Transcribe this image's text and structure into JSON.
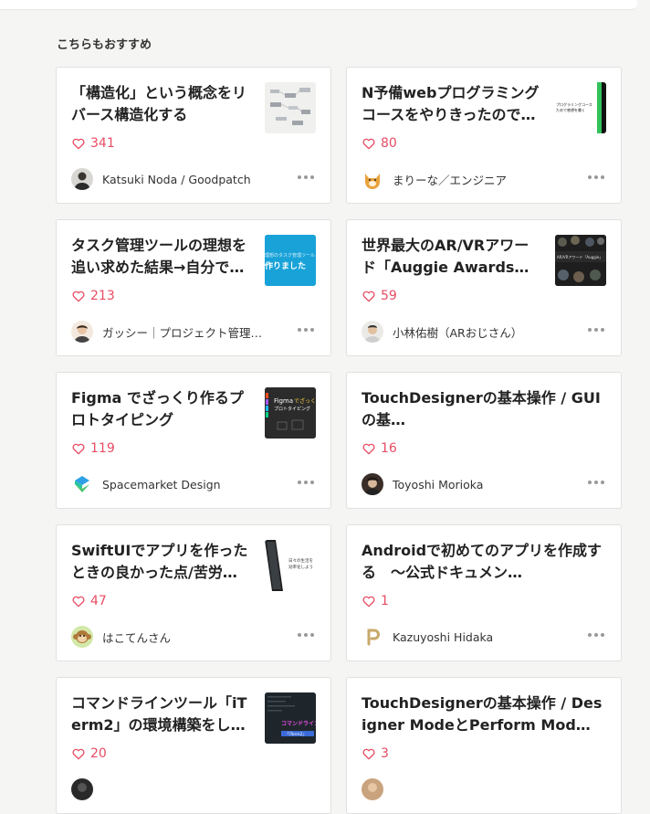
{
  "section": {
    "title": "こちらもおすすめ"
  },
  "articles": [
    {
      "title": "「構造化」という概念をリバース構造化する",
      "likes": "341",
      "author": "Katsuki Noda / Goodpatch",
      "thumb_icon": "diagram-thumbnail",
      "avatar_icon": "person-avatar",
      "thumb_text": "",
      "thumb_bg": "#eeeeee"
    },
    {
      "title": "N予備webプログラミングコースをやりきったので…",
      "likes": "80",
      "author": "まりーな／エンジニア",
      "thumb_icon": "text-thumbnail",
      "avatar_icon": "shiba-dog-avatar",
      "thumb_text": "プログラミングコースためで感想を書く",
      "thumb_bg": "#ffffff"
    },
    {
      "title": "タスク管理ツールの理想を追い求めた結果→自分で…",
      "likes": "213",
      "author": "ガッシー｜プロジェクト管理ツール「Lychee Redmine」開発者",
      "thumb_icon": "blue-text-thumbnail",
      "avatar_icon": "person-avatar",
      "thumb_text": "作りました",
      "thumb_bg": "#18a2d8"
    },
    {
      "title": "世界最大のAR/VRアワード「Auggie Awards」の…",
      "likes": "59",
      "author": "小林佑樹（ARおじさん）",
      "thumb_icon": "award-thumbnail",
      "avatar_icon": "person-avatar",
      "thumb_text": "",
      "thumb_bg": "#1e1e1e"
    },
    {
      "title": "Figma でざっくり作るプロトタイピング",
      "likes": "119",
      "author": "Spacemarket Design",
      "thumb_icon": "figma-thumbnail",
      "avatar_icon": "spacemarket-logo-avatar",
      "thumb_text": "Figmaでざっくり",
      "thumb_bg": "#2b2b2b"
    },
    {
      "title": "TouchDesignerの基本操作 / GUIの基…",
      "likes": "16",
      "author": "Toyoshi Morioka",
      "thumb_icon": "",
      "avatar_icon": "person-avatar",
      "thumb_text": "",
      "thumb_bg": ""
    },
    {
      "title": "SwiftUIでアプリを作ったときの良かった点/苦労…",
      "likes": "47",
      "author": "はこてんさん",
      "thumb_icon": "phone-thumbnail",
      "avatar_icon": "monkey-avatar",
      "thumb_text": "日々の生活を効率化しよう",
      "thumb_bg": "#ffffff"
    },
    {
      "title": "Androidで初めてのアプリを作成する　〜公式ドキュメン…",
      "likes": "1",
      "author": "Kazuyoshi Hidaka",
      "thumb_icon": "",
      "avatar_icon": "letter-p-avatar",
      "thumb_text": "",
      "thumb_bg": ""
    },
    {
      "title": "コマンドラインツール「iTerm2」の環境構築をしよ…",
      "likes": "20",
      "author": "",
      "thumb_icon": "terminal-thumbnail",
      "avatar_icon": "person-avatar",
      "thumb_text": "コマンドライン",
      "thumb_bg": "#1f262b"
    },
    {
      "title": "TouchDesignerの基本操作 / Designer ModeとPerform Mod…",
      "likes": "3",
      "author": "",
      "thumb_icon": "",
      "avatar_icon": "person-avatar",
      "thumb_text": "",
      "thumb_bg": ""
    }
  ],
  "colors": {
    "like": "#e84c63",
    "background": "#f5f5f3"
  }
}
